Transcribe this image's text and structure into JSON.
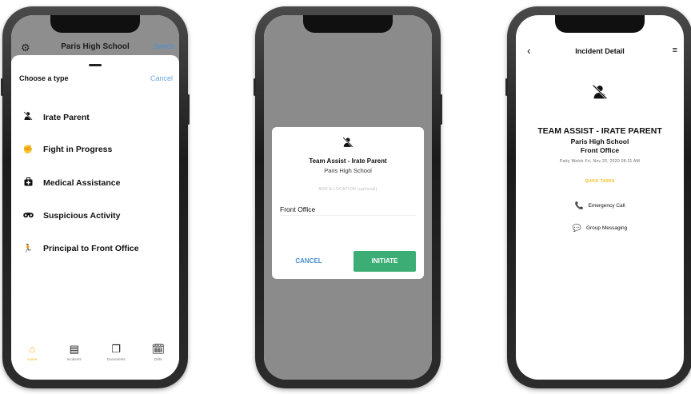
{
  "screen1": {
    "school": "Paris High School",
    "switch_label": "Switch",
    "sheet_title": "Choose a type",
    "cancel_label": "Cancel",
    "types": [
      {
        "label": "Irate Parent",
        "icon": "person-off-icon"
      },
      {
        "label": "Fight in Progress",
        "icon": "fist-icon"
      },
      {
        "label": "Medical Assistance",
        "icon": "medical-bag-icon"
      },
      {
        "label": "Suspicious Activity",
        "icon": "binoculars-icon"
      },
      {
        "label": "Principal to Front Office",
        "icon": "running-person-icon"
      }
    ],
    "tabs": [
      {
        "label": "Home",
        "icon": "home-icon"
      },
      {
        "label": "Incidents",
        "icon": "list-icon"
      },
      {
        "label": "Documents",
        "icon": "documents-icon"
      },
      {
        "label": "Drills",
        "icon": "calendar-check-icon"
      }
    ],
    "accent_color": "#f2b21d"
  },
  "screen2": {
    "dialog_title": "Team Assist - Irate Parent",
    "dialog_subtitle": "Paris High School",
    "location_label": "ADD A LOCATION (optional)",
    "location_value": "Front Office",
    "cancel_label": "CANCEL",
    "initiate_label": "INITIATE",
    "initiate_color": "#3cae75"
  },
  "screen3": {
    "title": "Incident Detail",
    "heading": "TEAM ASSIST - IRATE PARENT",
    "school": "Paris High School",
    "location": "Front Office",
    "meta": "Patty Welch   Fri, Nov 20, 2020   08:31 AM",
    "quick_tasks_label": "QUICK TASKS",
    "actions": [
      {
        "label": "Emergency Call",
        "icon": "phone-icon"
      },
      {
        "label": "Group Messaging",
        "icon": "message-icon"
      }
    ]
  }
}
